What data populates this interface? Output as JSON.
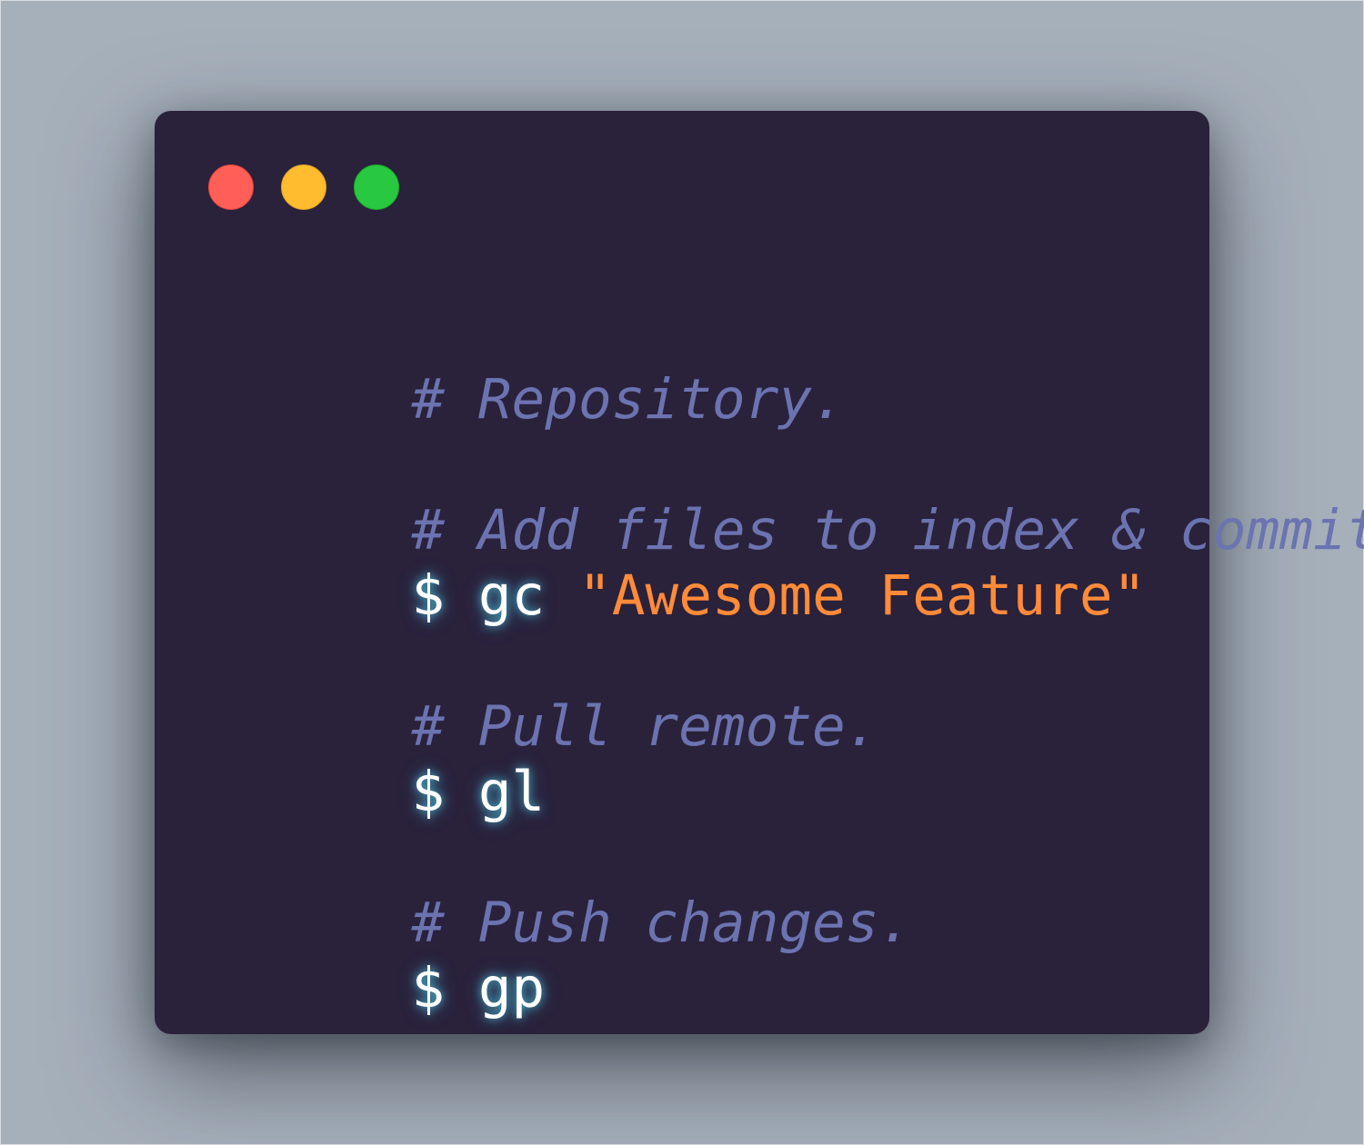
{
  "window": {
    "controls": {
      "close_color": "#ff5f57",
      "minimize_color": "#febc2e",
      "maximize_color": "#28c840"
    }
  },
  "terminal": {
    "lines": [
      {
        "comment": "# Repository."
      },
      {
        "comment": "# Add files to index & commit."
      },
      {
        "prompt": "$",
        "command": "gc",
        "argument": "\"Awesome Feature\""
      },
      {
        "comment": "# Pull remote."
      },
      {
        "prompt": "$",
        "command": "gl"
      },
      {
        "comment": "# Push changes."
      },
      {
        "prompt": "$",
        "command": "gp"
      }
    ]
  },
  "colors": {
    "background": "#a6b0bb",
    "window_bg": "#2a213b",
    "comment": "#6b73b0",
    "string": "#ff8b39",
    "command": "#ffffff"
  }
}
